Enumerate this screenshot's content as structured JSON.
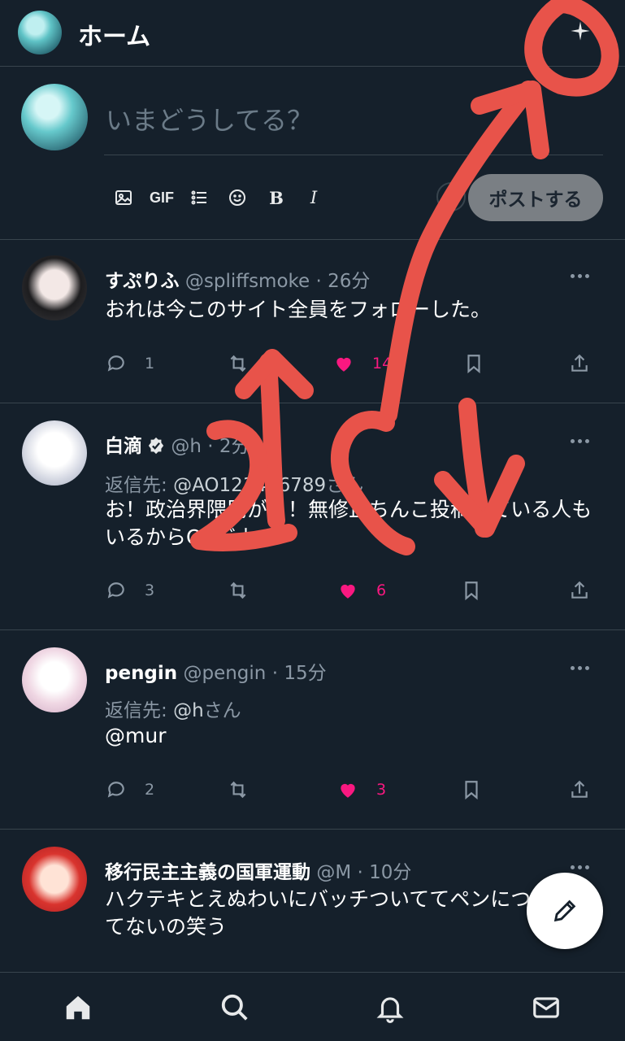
{
  "header": {
    "title": "ホーム",
    "avatar_icon": "user-avatar",
    "action_icon": "sparkle-icon"
  },
  "composer": {
    "placeholder": "いまどうしてる？",
    "gif_label": "GIF",
    "bold_label": "B",
    "italic_label": "I",
    "post_button": "ポストする"
  },
  "tweets": [
    {
      "name": "すぷりふ",
      "handle": "@spliffsmoke",
      "time": "· 26分",
      "body": "おれは今このサイト全員をフォローした。",
      "reply_count": "1",
      "like_count": "14"
    },
    {
      "name": "白滴",
      "handle": "@h",
      "time": "· 2分",
      "reply_to_label": "返信先: ",
      "reply_to_handle": "@AO123456789",
      "reply_to_suffix": "さん",
      "body": "お！政治界隈民が！！無修正ちんこ投稿している人もいるからOKだよ",
      "reply_count": "3",
      "like_count": "6"
    },
    {
      "name": "pengin",
      "handle": "@pengin",
      "time": "· 15分",
      "reply_to_label": "返信先: ",
      "reply_to_handle": "@h",
      "reply_to_suffix": "さん",
      "body": "@mur",
      "reply_count": "2",
      "like_count": "3"
    },
    {
      "name": "移行民主主義の国軍運動",
      "handle": "@M",
      "time": "· 10分",
      "body": "ハクテキとえぬわいにバッチついててペンについてないの笑う"
    }
  ],
  "colors": {
    "background": "#15202b",
    "like": "#f91880",
    "muted": "#8b98a5",
    "annotation": "#e8534a"
  },
  "bottom_nav": [
    "home-icon",
    "search-icon",
    "bell-icon",
    "mail-icon"
  ]
}
